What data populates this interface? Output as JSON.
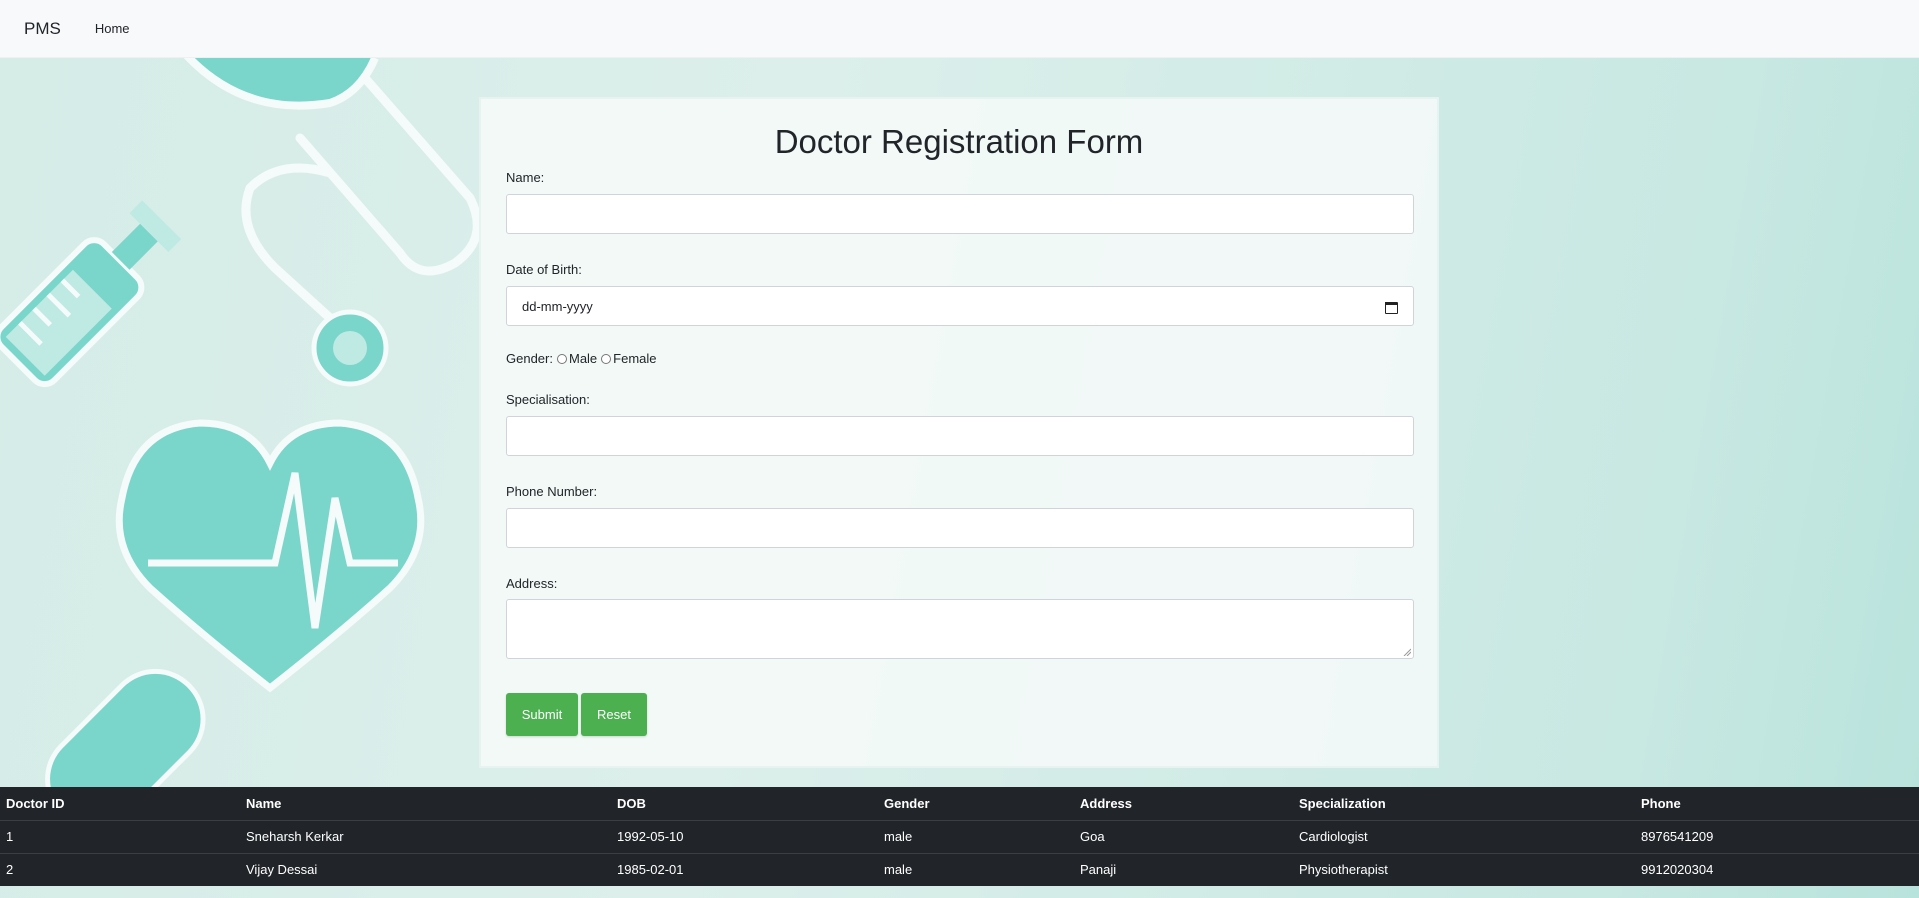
{
  "navbar": {
    "brand": "PMS",
    "home": "Home"
  },
  "form": {
    "title": "Doctor Registration Form",
    "name_label": "Name:",
    "dob_label": "Date of Birth:",
    "dob_placeholder": "dd-mm-yyyy",
    "gender_label": "Gender:",
    "gender_options": [
      "Male",
      "Female"
    ],
    "specialisation_label": "Specialisation:",
    "phone_label": "Phone Number:",
    "address_label": "Address:",
    "submit": "Submit",
    "reset": "Reset"
  },
  "table": {
    "headers": [
      "Doctor ID",
      "Name",
      "DOB",
      "Gender",
      "Address",
      "Specialization",
      "Phone"
    ],
    "rows": [
      [
        "1",
        "Sneharsh Kerkar",
        "1992-05-10",
        "male",
        "Goa",
        "Cardiologist",
        "8976541209"
      ],
      [
        "2",
        "Vijay Dessai",
        "1985-02-01",
        "male",
        "Panaji",
        "Physiotherapist",
        "9912020304"
      ]
    ]
  },
  "colors": {
    "accent": "#4caf50",
    "teal": "#7ad6ca",
    "table_bg": "#212529"
  },
  "icons": [
    "stethoscope-icon",
    "syringe-icon",
    "heart-pulse-icon",
    "pill-icon",
    "calendar-icon"
  ]
}
